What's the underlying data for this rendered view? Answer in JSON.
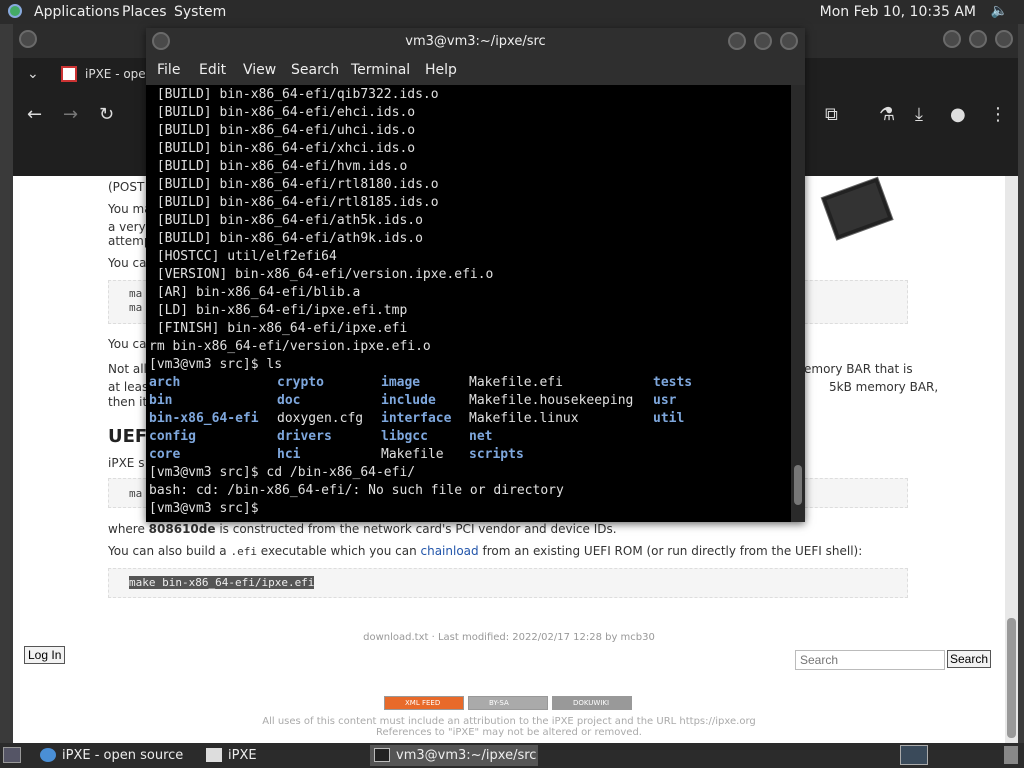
{
  "top_panel": {
    "applications": "Applications",
    "places": "Places",
    "system": "System",
    "clock": "Mon Feb 10, 10:35 AM"
  },
  "browser": {
    "tab_title": "iPXE - ope",
    "content": {
      "line_post": "(POST",
      "line_you_ma": "You ma",
      "line_a_very": "a very",
      "line_attemp": "attemp",
      "line_you_ca1": "You ca",
      "code1_line1": "ma",
      "code1_line2": "ma",
      "line_you_ca2": "You ca",
      "line_not_all": "Not all",
      "line_at_leas": "at leas",
      "line_then_it": "then it",
      "right_memory_bar": "emory BAR that is",
      "right_5kb": "5kB memory BAR,",
      "heading_uefi": "UEFI",
      "line_ipxe_s": "iPXE s",
      "code2_line1": "ma",
      "where_prefix": "where ",
      "where_bold": "808610de",
      "where_suffix": " is constructed from the network card's PCI vendor and device IDs.",
      "also_prefix": "You can also build a ",
      "also_code": ".efi",
      "also_middle": " executable which you can ",
      "also_link": "chainload",
      "also_suffix": " from an existing UEFI ROM (or run directly from the UEFI shell):",
      "code3": "make bin-x86_64-efi/ipxe.efi"
    },
    "footer": {
      "meta": "download.txt · Last modified: 2022/02/17 12:28 by mcb30",
      "login": "Log In",
      "search_placeholder": "Search",
      "search_button": "Search",
      "badge_rss": "XML FEED",
      "badge_cc": "BY-SA",
      "badge_dokuwiki": "DOKUWIKI",
      "license_line1": "All uses of this content must include an attribution to the iPXE project and the URL https://ipxe.org",
      "license_line2": "References to \"iPXE\" may not be altered or removed."
    }
  },
  "terminal": {
    "title": "vm3@vm3:~/ipxe/src",
    "menu": [
      "File",
      "Edit",
      "View",
      "Search",
      "Terminal",
      "Help"
    ],
    "lines": [
      " [BUILD] bin-x86_64-efi/qib7322.ids.o",
      " [BUILD] bin-x86_64-efi/ehci.ids.o",
      " [BUILD] bin-x86_64-efi/uhci.ids.o",
      " [BUILD] bin-x86_64-efi/xhci.ids.o",
      " [BUILD] bin-x86_64-efi/hvm.ids.o",
      " [BUILD] bin-x86_64-efi/rtl8180.ids.o",
      " [BUILD] bin-x86_64-efi/rtl8185.ids.o",
      " [BUILD] bin-x86_64-efi/ath5k.ids.o",
      " [BUILD] bin-x86_64-efi/ath9k.ids.o",
      " [HOSTCC] util/elf2efi64",
      " [VERSION] bin-x86_64-efi/version.ipxe.efi.o",
      " [AR] bin-x86_64-efi/blib.a",
      " [LD] bin-x86_64-efi/ipxe.efi.tmp",
      " [FINISH] bin-x86_64-efi/ipxe.efi",
      "rm bin-x86_64-efi/version.ipxe.efi.o",
      "[vm3@vm3 src]$ ls"
    ],
    "ls": {
      "col1": [
        {
          "text": "arch",
          "dir": true
        },
        {
          "text": "bin",
          "dir": true
        },
        {
          "text": "bin-x86_64-efi",
          "dir": true
        },
        {
          "text": "config",
          "dir": true
        },
        {
          "text": "core",
          "dir": true
        }
      ],
      "col2": [
        {
          "text": "crypto",
          "dir": true
        },
        {
          "text": "doc",
          "dir": true
        },
        {
          "text": "doxygen.cfg",
          "dir": false
        },
        {
          "text": "drivers",
          "dir": true
        },
        {
          "text": "hci",
          "dir": true
        }
      ],
      "col3": [
        {
          "text": "image",
          "dir": true
        },
        {
          "text": "include",
          "dir": true
        },
        {
          "text": "interface",
          "dir": true
        },
        {
          "text": "libgcc",
          "dir": true
        },
        {
          "text": "Makefile",
          "dir": false
        }
      ],
      "col4": [
        {
          "text": "Makefile.efi",
          "dir": false
        },
        {
          "text": "Makefile.housekeeping",
          "dir": false
        },
        {
          "text": "Makefile.linux",
          "dir": false
        },
        {
          "text": "net",
          "dir": true
        },
        {
          "text": "scripts",
          "dir": true
        }
      ],
      "col5": [
        {
          "text": "tests",
          "dir": true
        },
        {
          "text": "usr",
          "dir": true
        },
        {
          "text": "util",
          "dir": true
        }
      ]
    },
    "tail": [
      "[vm3@vm3 src]$ cd /bin-x86_64-efi/",
      "bash: cd: /bin-x86_64-efi/: No such file or directory",
      "[vm3@vm3 src]$ "
    ]
  },
  "taskbar": {
    "tasks": [
      "iPXE - open source ...",
      "iPXE",
      "vm3@vm3:~/ipxe/src"
    ]
  },
  "colors": {
    "terminal_dir": "#7ea7dd",
    "link": "#2255aa"
  }
}
